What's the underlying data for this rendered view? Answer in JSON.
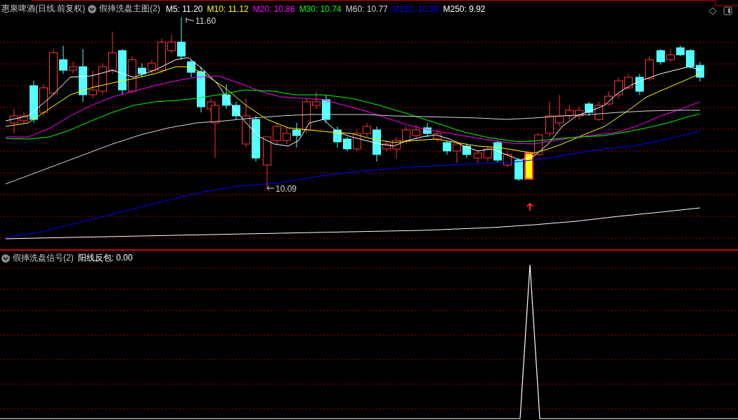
{
  "main_panel": {
    "stock_name": "惠泉啤酒(日线.前复权)",
    "indicator": "假摔洗盘主图(2)",
    "moving_averages": [
      {
        "label": "M5: 11.20",
        "color": "#ffffff"
      },
      {
        "label": "M10: 11.12",
        "color": "#ffff00"
      },
      {
        "label": "M20: 10.86",
        "color": "#ff00ff"
      },
      {
        "label": "M30: 10.74",
        "color": "#00ff00"
      },
      {
        "label": "M60: 10.77",
        "color": "#d0d0d0"
      },
      {
        "label": "M120: 10.59",
        "color": "#0000ff"
      },
      {
        "label": "M250: 9.92",
        "color": "#ffffff"
      }
    ],
    "high_label": "11.60",
    "low_label": "10.09"
  },
  "signal_panel": {
    "indicator": "假摔洗盘信号(2)",
    "readout": "阳线反包: 0.00"
  }
}
